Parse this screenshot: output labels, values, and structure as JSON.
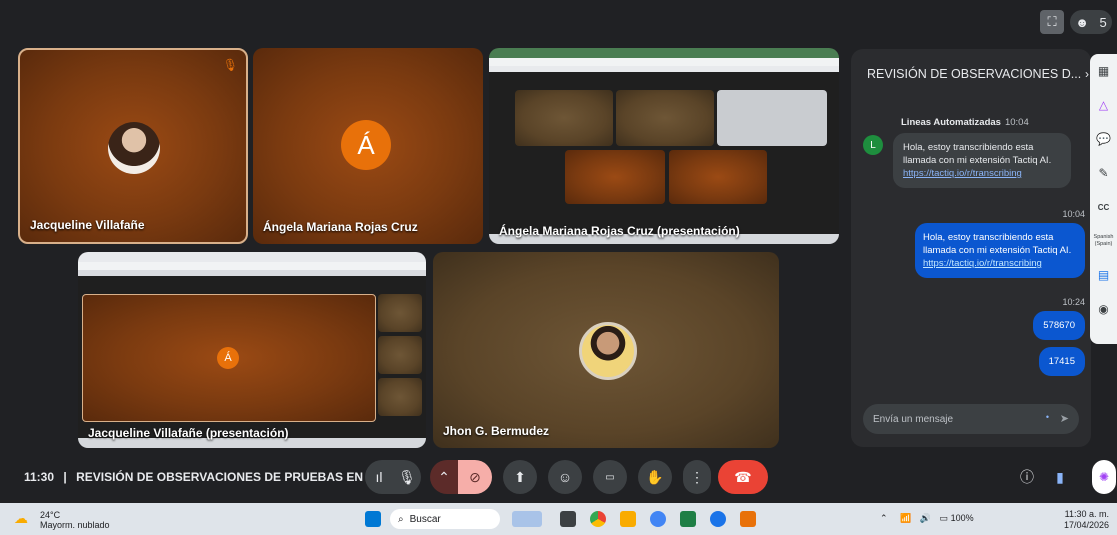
{
  "participants": {
    "jacqueline": {
      "name": "Jacqueline Villafañe"
    },
    "angela": {
      "name": "Ángela Mariana Rojas Cruz",
      "initial": "Á"
    },
    "angela_pres": {
      "name": "Ángela Mariana Rojas Cruz (presentación)"
    },
    "jacqueline_pres": {
      "name": "Jacqueline Villafañe (presentación)"
    },
    "jhon": {
      "name": "Jhon G. Bermudez"
    }
  },
  "top": {
    "people_count": "5"
  },
  "chat": {
    "title": "REVISIÓN DE OBSERVACIONES D...",
    "sender": "Lineas Automatizadas",
    "sender_time": "10:04",
    "avatar_letter": "L",
    "msg1_text": "Hola, estoy transcribiendo esta llamada con mi extensión Tactiq AI.",
    "msg1_link": "https://tactiq.io/r/transcribing",
    "msg2_time": "10:04",
    "msg2_text": "Hola, estoy transcribiendo esta llamada con mi extensión Tactiq AI.",
    "msg2_link": "https://tactiq.io/r/transcribing",
    "msg3_time": "10:24",
    "msg3_text": "578670",
    "msg4_text": "17415",
    "input_placeholder": "Envía un mensaje"
  },
  "sidebar": {
    "spanish_label": "Spanish (Spain)"
  },
  "meeting": {
    "time": "11:30",
    "separator": "|",
    "title": "REVISIÓN DE OBSERVACIONES DE PRUEBAS EN ..."
  },
  "taskbar": {
    "temp": "24°C",
    "weather": "Mayorm. nublado",
    "search": "Buscar",
    "battery": "100%",
    "time": "11:30 a. m.",
    "date": "17/04/2026"
  },
  "colors": {
    "end_call": "#ea4335",
    "cam_off": "#f6aea9",
    "accent": "#e8710a"
  }
}
